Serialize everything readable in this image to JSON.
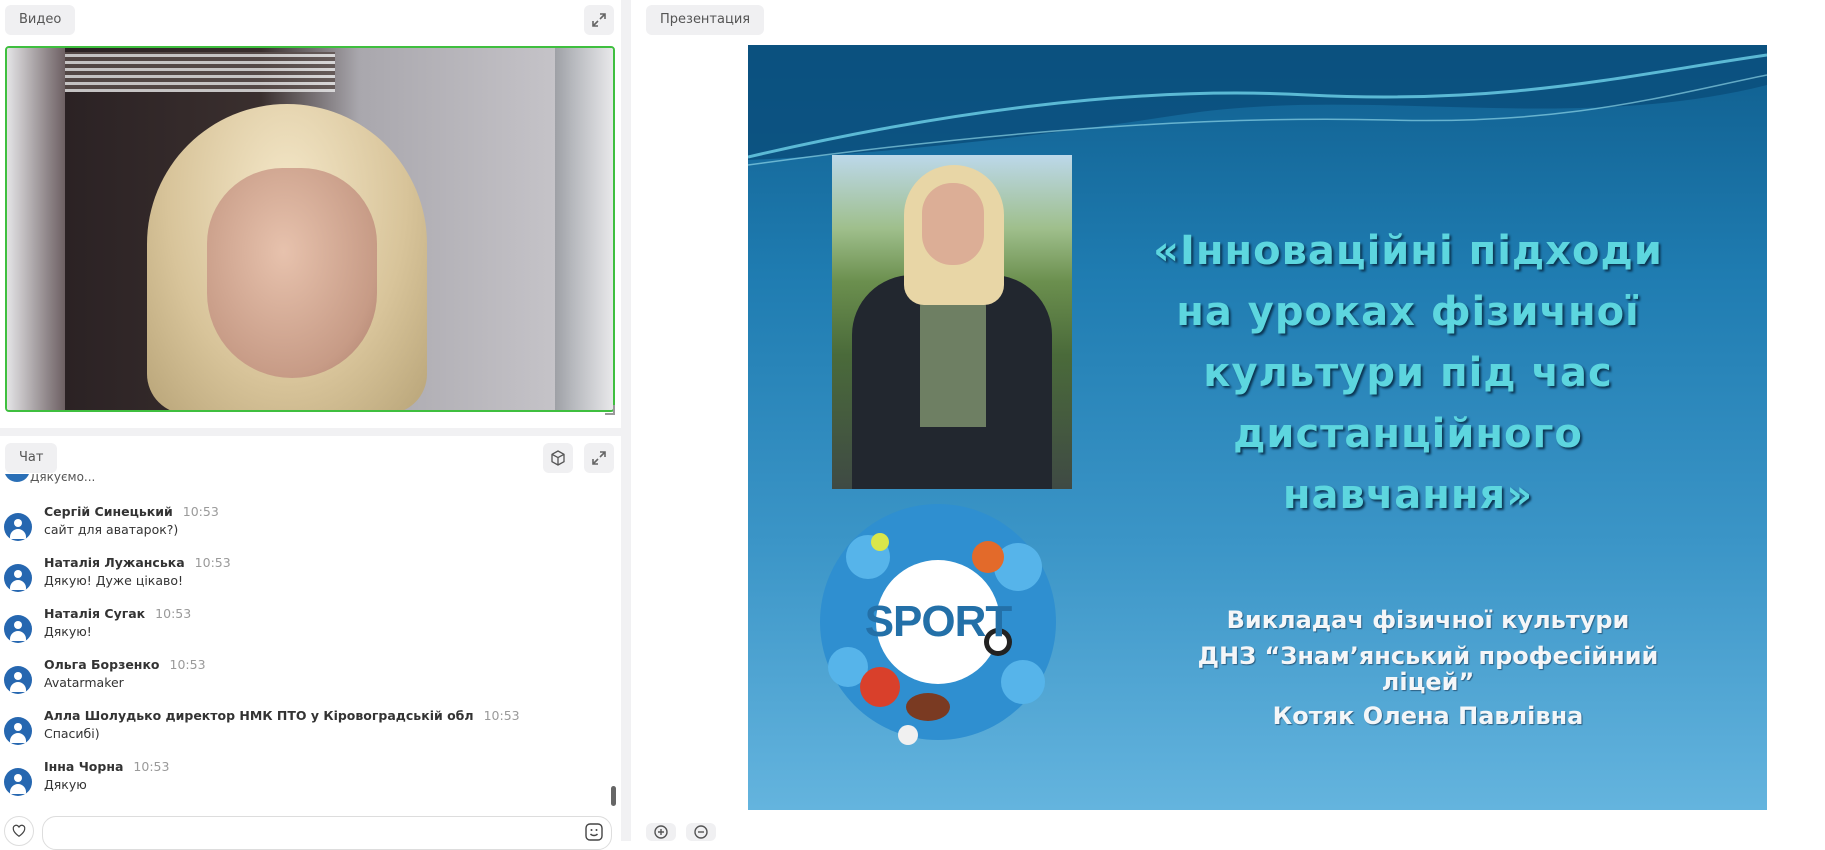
{
  "video_panel": {
    "tab_label": "Видео",
    "expand_icon": "expand-icon"
  },
  "chat_panel": {
    "tab_label": "Чат",
    "cube_icon": "cube-icon",
    "expand_icon": "expand-icon",
    "cut_off_message": "Дякуємо...",
    "messages": [
      {
        "name": "Сергій Синецький",
        "time": "10:53",
        "text": "сайт для аватарок?)"
      },
      {
        "name": "Наталія Лужанська",
        "time": "10:53",
        "text": "Дякую! Дуже цікаво!"
      },
      {
        "name": "Наталія Сугак",
        "time": "10:53",
        "text": "Дякую!"
      },
      {
        "name": "Ольга Борзенко",
        "time": "10:53",
        "text": "Avatarmaker"
      },
      {
        "name": "Алла Шолудько директор НМК ПТО у Кіровоградській обл",
        "time": "10:53",
        "text": "Спасибі)"
      },
      {
        "name": "Інна Чорна",
        "time": "10:53",
        "text": "Дякую"
      }
    ],
    "input": {
      "value": "",
      "placeholder": ""
    },
    "heart_icon": "heart-icon",
    "emoji_icon": "emoji-icon"
  },
  "presentation_panel": {
    "tab_label": "Презентация",
    "slide": {
      "title_lines": [
        "«Інноваційні підходи",
        "на уроках фізичної",
        "культури під час",
        "дистанційного",
        "навчання»"
      ],
      "subtitle_lines": [
        "Викладач фізичної культури",
        "ДНЗ “Знам’янський професійний",
        "ліцей”",
        "Котяк Олена Павлівна"
      ],
      "logo_text": "SPORT"
    },
    "zoom_in_icon": "zoom-in-icon",
    "zoom_out_icon": "zoom-out-icon"
  },
  "colors": {
    "video_border": "#3fbf3f",
    "avatar": "#2667b0",
    "slide_title": "#5dd6df"
  }
}
